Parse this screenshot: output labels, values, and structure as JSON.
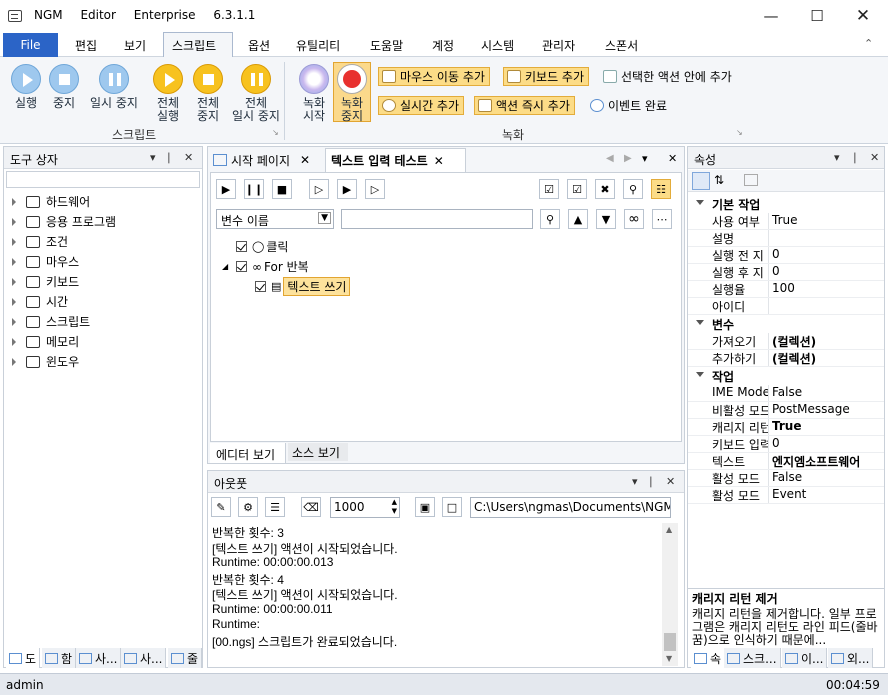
{
  "app": {
    "name": "NGM Editor",
    "edition": "Enterprise 6.3.1.1"
  },
  "menu": {
    "file": "File",
    "items": [
      "편집",
      "보기",
      "스크립트",
      "옵션",
      "유틸리티",
      "도움말",
      "계정",
      "시스템",
      "관리자",
      "스폰서"
    ],
    "active_index": 2
  },
  "ribbon": {
    "script_group": {
      "label": "스크립트",
      "buttons": [
        {
          "label": "실행",
          "icon": "play-icon"
        },
        {
          "label": "중지",
          "icon": "stop-icon"
        },
        {
          "label": "일시 중지",
          "icon": "pause-icon"
        },
        {
          "label": "전체\n실행",
          "icon": "play-icon"
        },
        {
          "label": "전체\n중지",
          "icon": "stop-icon"
        },
        {
          "label": "전체\n일시 중지",
          "icon": "pause-icon"
        }
      ]
    },
    "record_group": {
      "label": "녹화",
      "record_start": "녹화\n시작",
      "record_stop": "녹화\n중지",
      "small": [
        "마우스 이동 추가",
        "키보드 추가",
        "선택한 액션 안에 추가",
        "실시간 추가",
        "액션 즉시 추가",
        "이벤트 완료"
      ]
    }
  },
  "toolbox": {
    "title": "도구 상자",
    "items": [
      "하드웨어",
      "응용 프로그램",
      "조건",
      "마우스",
      "키보드",
      "시간",
      "스크립트",
      "메모리",
      "윈도우"
    ],
    "bottom_tabs": [
      "도",
      "함",
      "사...",
      "사...",
      "줄"
    ]
  },
  "editor": {
    "tabs": [
      {
        "label": "시작 페이지"
      },
      {
        "label": "텍스트 입력 테스트"
      }
    ],
    "var_select": "변수 이름",
    "tree": [
      {
        "label": "클릭",
        "indent": 0
      },
      {
        "label": "For 반복",
        "indent": 0
      },
      {
        "label": "텍스트 쓰기",
        "indent": 1
      }
    ],
    "view_tabs": [
      "에디터 보기",
      "소스 보기"
    ]
  },
  "output": {
    "title": "아웃풋",
    "count": "1000",
    "path": "C:\\Users\\ngmas\\Documents\\NGM6\\",
    "lines": [
      "반복한 횟수: 3",
      "[텍스트 쓰기] 액션이 시작되었습니다.",
      "Runtime: 00:00:00.013",
      "반복한 횟수: 4",
      "[텍스트 쓰기] 액션이 시작되었습니다.",
      "Runtime: 00:00:00.011",
      "Runtime:",
      "[00.ngs] 스크립트가 완료되었습니다."
    ]
  },
  "properties": {
    "title": "속성",
    "categories": [
      {
        "name": "기본 작업",
        "rows": [
          [
            "사용 여부",
            "True"
          ],
          [
            "설명",
            ""
          ],
          [
            "실행 전 지",
            "0"
          ],
          [
            "실행 후 지",
            "0"
          ],
          [
            "실행율",
            "100"
          ],
          [
            "아이디",
            ""
          ]
        ]
      },
      {
        "name": "변수",
        "rows": [
          [
            "가져오기",
            "(컬렉션)"
          ],
          [
            "추가하기",
            "(컬렉션)"
          ]
        ]
      },
      {
        "name": "작업",
        "rows": [
          [
            "IME Mode",
            "False"
          ],
          [
            "비활성 모드",
            "PostMessage"
          ],
          [
            "캐리지 리턴",
            "True"
          ],
          [
            "키보드 입력",
            "0"
          ],
          [
            "텍스트",
            "엔지엠소프트웨어"
          ],
          [
            "활성 모드",
            "False"
          ],
          [
            "활성 모드",
            "Event"
          ]
        ]
      }
    ],
    "desc_title": "캐리지 리턴 제거",
    "desc_text": "캐리지 리턴을 제거합니다. 일부 프로그램은 캐리지 리턴도 라인 피드(줄바꿈)으로 인식하기 때문에...",
    "bottom_tabs": [
      "속",
      "스크...",
      "이...",
      "외..."
    ]
  },
  "status": {
    "user": "admin",
    "time": "00:04:59"
  }
}
